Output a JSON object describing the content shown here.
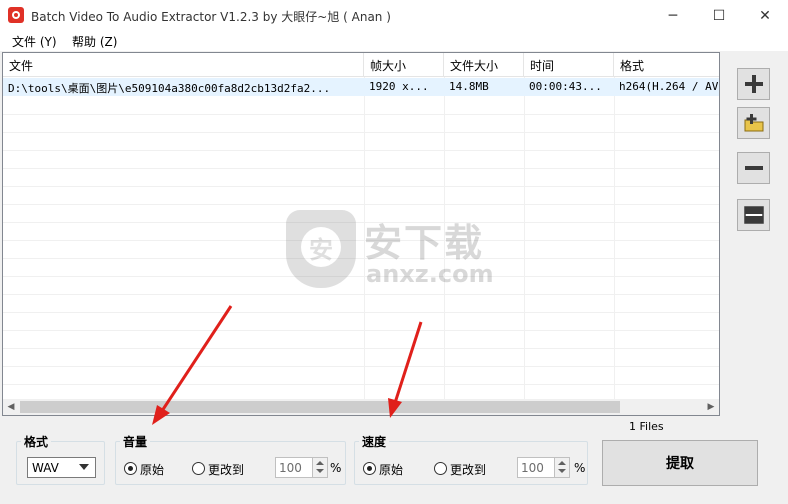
{
  "window": {
    "title": "Batch Video To Audio Extractor V1.2.3 by 大眼仔~旭 ( Anan )",
    "minimize_glyph": "─",
    "maximize_glyph": "☐",
    "close_glyph": "✕"
  },
  "menu": {
    "items": [
      {
        "label": "文件 (Y)"
      },
      {
        "label": "帮助 (Z)"
      }
    ]
  },
  "file_list": {
    "columns": [
      "文件",
      "帧大小",
      "文件大小",
      "时间",
      "格式"
    ],
    "rows": [
      {
        "file": "D:\\tools\\桌面\\图片\\e509104a380c00fa8d2cb13d2fa2...",
        "frame_size": "1920 x...",
        "file_size": "14.8MB",
        "duration": "00:00:43...",
        "format": "h264(H.264 / AV"
      }
    ]
  },
  "watermark": {
    "glyph": "安",
    "title": "安下载",
    "subtitle": "anxz.com"
  },
  "side_buttons": [
    {
      "icon": "plus-icon"
    },
    {
      "icon": "folder-add-icon"
    },
    {
      "icon": "minus-icon"
    },
    {
      "icon": "clear-list-icon"
    }
  ],
  "format_group": {
    "title": "格式",
    "selected": "WAV"
  },
  "volume_group": {
    "title": "音量",
    "original_label": "原始",
    "change_label": "更改到",
    "value": "100",
    "unit": "%",
    "selected": "original"
  },
  "speed_group": {
    "title": "速度",
    "original_label": "原始",
    "change_label": "更改到",
    "value": "100",
    "unit": "%",
    "selected": "original"
  },
  "status": {
    "files_count": "1 Files"
  },
  "extract_button": {
    "label": "提取"
  },
  "annotation_color": "#e0201b"
}
